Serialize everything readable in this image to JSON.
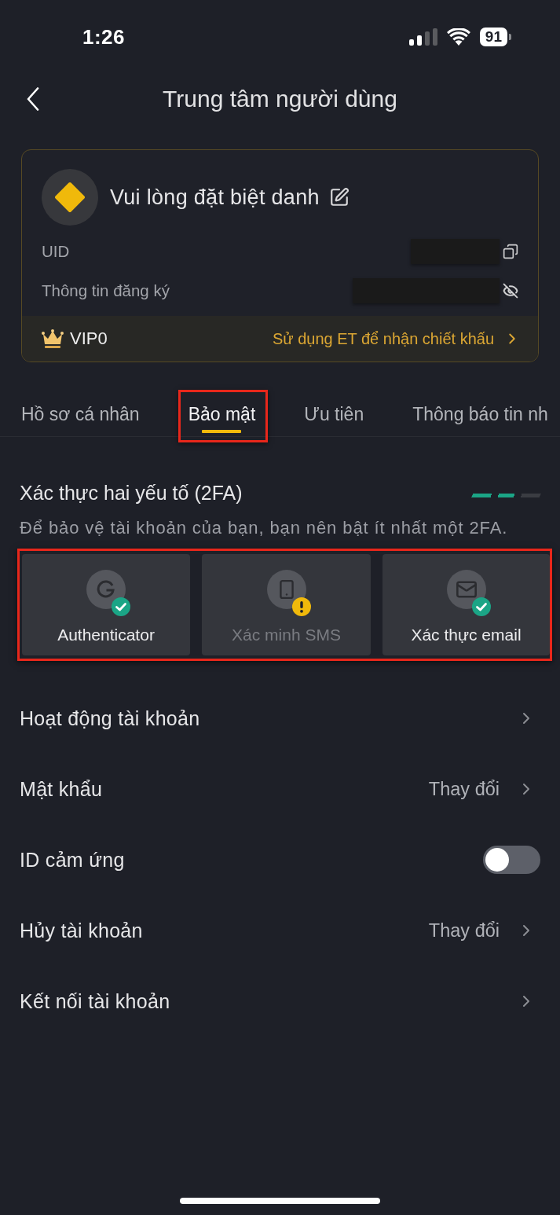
{
  "status_bar": {
    "time": "1:26",
    "battery": "91"
  },
  "header": {
    "title": "Trung tâm người dùng"
  },
  "profile": {
    "nickname": "Vui lòng đặt biệt danh",
    "info_rows": [
      {
        "kind": "copy",
        "label": "UID",
        "redacted": true
      },
      {
        "kind": "hide",
        "label": "Thông tin đăng ký",
        "redacted": true
      }
    ],
    "vip": {
      "tier": "VIP0",
      "link": "Sử dụng ET để nhận chiết khấu"
    }
  },
  "tabs": [
    {
      "label": "Hồ sơ cá nhân",
      "selected": false,
      "highlighted": false
    },
    {
      "label": "Bảo mật",
      "selected": true,
      "highlighted": true
    },
    {
      "label": "Ưu tiên",
      "selected": false,
      "highlighted": false
    },
    {
      "label": "Thông báo tin nh",
      "selected": false,
      "highlighted": false
    }
  ],
  "two_factor": {
    "title": "Xác thực hai yếu tố (2FA)",
    "strength": {
      "level": 0.67
    },
    "hint": "Để bảo vệ tài khoản của bạn, bạn nên bật ít nhất một 2FA.",
    "highlighted": true,
    "methods": [
      {
        "kind": "authenticator",
        "label": "Authenticator",
        "verified": true
      },
      {
        "kind": "sms",
        "label": "Xác minh SMS",
        "verified": false
      },
      {
        "kind": "email",
        "label": "Xác thực email",
        "verified": true
      }
    ]
  },
  "security_rows": [
    {
      "kind": "link",
      "label": "Hoạt động tài khoản"
    },
    {
      "kind": "link",
      "label": "Mật khẩu",
      "value": "Thay đổi"
    },
    {
      "kind": "toggle",
      "label": "ID cảm ứng",
      "on": false
    },
    {
      "kind": "link",
      "label": "Hủy tài khoản",
      "value": "Thay đổi"
    },
    {
      "kind": "link",
      "label": "Kết nối tài khoản"
    }
  ]
}
